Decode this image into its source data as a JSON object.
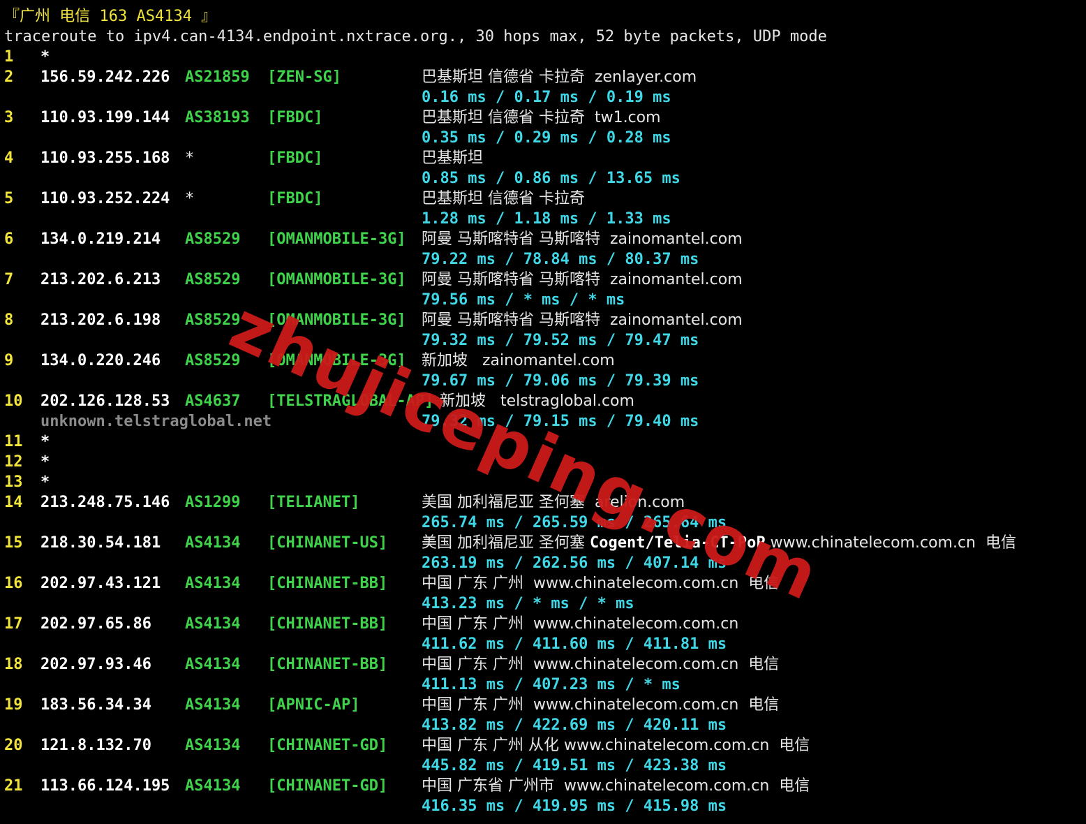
{
  "header": {
    "title": "『广州 电信 163 AS4134 』",
    "command": "traceroute to ipv4.can-4134.endpoint.nxtrace.org., 30 hops max, 52 byte packets, UDP mode"
  },
  "hops": [
    {
      "n": "1",
      "ip": "*"
    },
    {
      "n": "2",
      "ip": "156.59.242.226",
      "as": "AS21859",
      "tag": "[ZEN-SG]",
      "loc": "巴基斯坦 信德省 卡拉奇  zenlayer.com",
      "rtt": "0.16 ms / 0.17 ms / 0.19 ms"
    },
    {
      "n": "3",
      "ip": "110.93.199.144",
      "as": "AS38193",
      "tag": "[FBDC]",
      "loc": "巴基斯坦 信德省 卡拉奇  tw1.com",
      "rtt": "0.35 ms / 0.29 ms / 0.28 ms"
    },
    {
      "n": "4",
      "ip": "110.93.255.168",
      "as": "*",
      "tag": "[FBDC]",
      "loc": "巴基斯坦",
      "rtt": "0.85 ms / 0.86 ms / 13.65 ms"
    },
    {
      "n": "5",
      "ip": "110.93.252.224",
      "as": "*",
      "tag": "[FBDC]",
      "loc": "巴基斯坦 信德省 卡拉奇",
      "rtt": "1.28 ms / 1.18 ms / 1.33 ms"
    },
    {
      "n": "6",
      "ip": "134.0.219.214",
      "as": "AS8529",
      "tag": "[OMANMOBILE-3G]",
      "loc": "阿曼 马斯喀特省 马斯喀特  zainomantel.com",
      "rtt": "79.22 ms / 78.84 ms / 80.37 ms"
    },
    {
      "n": "7",
      "ip": "213.202.6.213",
      "as": "AS8529",
      "tag": "[OMANMOBILE-3G]",
      "loc": "阿曼 马斯喀特省 马斯喀特  zainomantel.com",
      "rtt": "79.56 ms / * ms / * ms"
    },
    {
      "n": "8",
      "ip": "213.202.6.198",
      "as": "AS8529",
      "tag": "[OMANMOBILE-3G]",
      "loc": "阿曼 马斯喀特省 马斯喀特  zainomantel.com",
      "rtt": "79.32 ms / 79.52 ms / 79.47 ms"
    },
    {
      "n": "9",
      "ip": "134.0.220.246",
      "as": "AS8529",
      "tag": "[OMANMOBILE-3G]",
      "loc": "新加坡   zainomantel.com",
      "rtt": "79.67 ms / 79.06 ms / 79.39 ms"
    },
    {
      "n": "10",
      "ip": "202.126.128.53",
      "as": "AS4637",
      "tag": "[TELSTRAGLOBAL-AP]",
      "loc": "新加坡   telstraglobal.com",
      "host": "unknown.telstraglobal.net",
      "rtt": "79.32 ms / 79.15 ms / 79.40 ms"
    },
    {
      "n": "11",
      "ip": "*"
    },
    {
      "n": "12",
      "ip": "*"
    },
    {
      "n": "13",
      "ip": "*"
    },
    {
      "n": "14",
      "ip": "213.248.75.146",
      "as": "AS1299",
      "tag": "[TELIANET]",
      "loc": "美国 加利福尼亚 圣何塞  arelion.com",
      "rtt": "265.74 ms / 265.59 ms / 265.64 ms"
    },
    {
      "n": "15",
      "ip": "218.30.54.181",
      "as": "AS4134",
      "tag": "[CHINANET-US]",
      "loc_a": "美国 加利福尼亚 圣何塞 ",
      "loc_b": "Cogent/Telia-CT-PoP",
      "loc_c": " www.chinatelecom.com.cn  电信",
      "rtt": "263.19 ms / 262.56 ms / 407.14 ms"
    },
    {
      "n": "16",
      "ip": "202.97.43.121",
      "as": "AS4134",
      "tag": "[CHINANET-BB]",
      "loc": "中国 广东 广州  www.chinatelecom.com.cn  电信",
      "rtt": "413.23 ms / * ms / * ms"
    },
    {
      "n": "17",
      "ip": "202.97.65.86",
      "as": "AS4134",
      "tag": "[CHINANET-BB]",
      "loc": "中国 广东 广州  www.chinatelecom.com.cn",
      "rtt": "411.62 ms / 411.60 ms / 411.81 ms"
    },
    {
      "n": "18",
      "ip": "202.97.93.46",
      "as": "AS4134",
      "tag": "[CHINANET-BB]",
      "loc": "中国 广东 广州  www.chinatelecom.com.cn  电信",
      "rtt": "411.13 ms / 407.23 ms / * ms"
    },
    {
      "n": "19",
      "ip": "183.56.34.34",
      "as": "AS4134",
      "tag": "[APNIC-AP]",
      "loc": "中国 广东 广州  www.chinatelecom.com.cn  电信",
      "rtt": "413.82 ms / 422.69 ms / 420.11 ms"
    },
    {
      "n": "20",
      "ip": "121.8.132.70",
      "as": "AS4134",
      "tag": "[CHINANET-GD]",
      "loc": "中国 广东 广州 从化 www.chinatelecom.com.cn  电信",
      "rtt": "445.82 ms / 419.51 ms / 423.38 ms"
    },
    {
      "n": "21",
      "ip": "113.66.124.195",
      "as": "AS4134",
      "tag": "[CHINANET-GD]",
      "loc": "中国 广东省 广州市  www.chinatelecom.com.cn  电信",
      "rtt": "416.35 ms / 419.95 ms / 415.98 ms"
    }
  ],
  "watermark": "zhujiceping.com"
}
